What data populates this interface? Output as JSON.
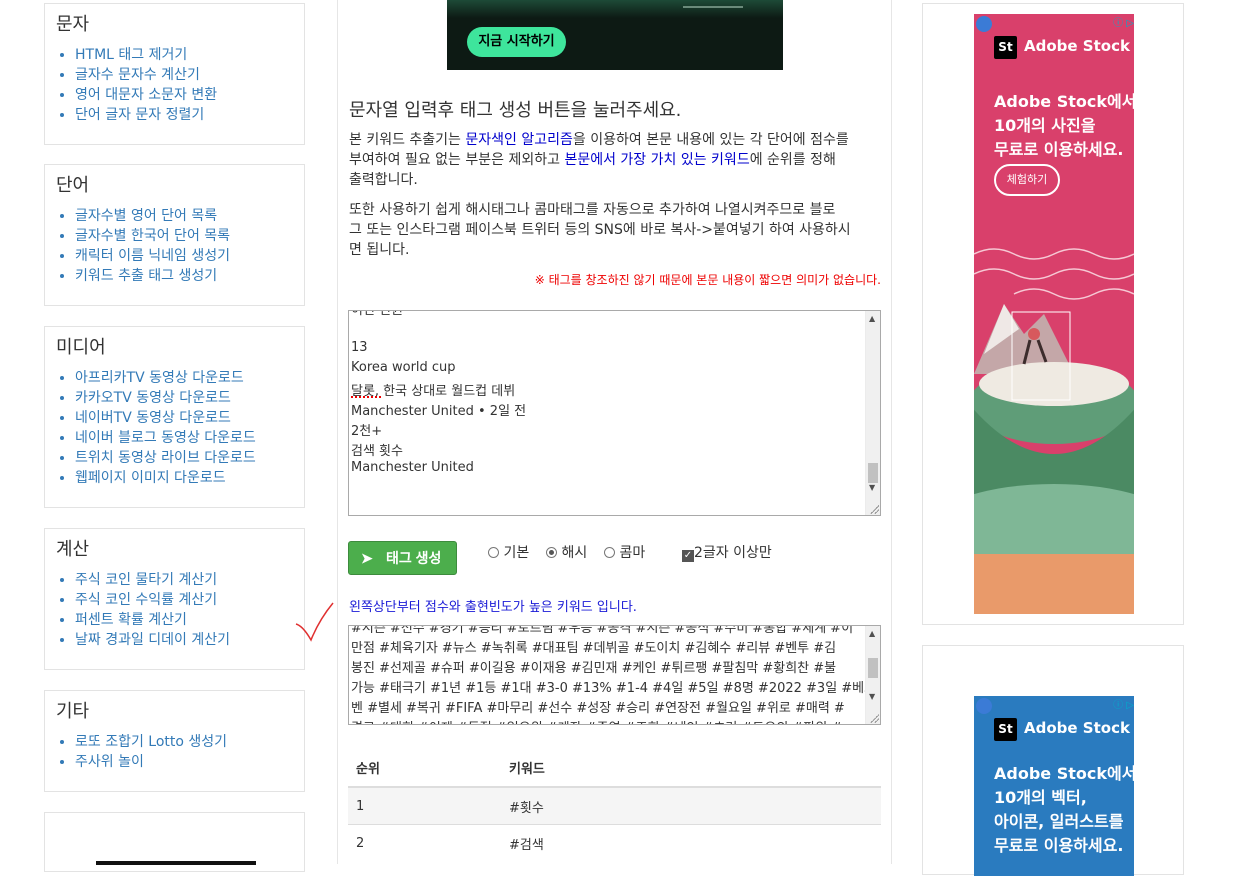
{
  "sidebar": {
    "panels": [
      {
        "title": "문자",
        "items": [
          "HTML 태그 제거기",
          "글자수 문자수 계산기",
          "영어 대문자 소문자 변환",
          "단어 글자 문자 정렬기"
        ]
      },
      {
        "title": "단어",
        "items": [
          "글자수별 영어 단어 목록",
          "글자수별 한국어 단어 목록",
          "캐릭터 이름 닉네임 생성기",
          "키워드 추출 태그 생성기"
        ]
      },
      {
        "title": "미디어",
        "items": [
          "아프리카TV 동영상 다운로드",
          "카카오TV 동영상 다운로드",
          "네이버TV 동영상 다운로드",
          "네이버 블로그 동영상 다운로드",
          "트위치 동영상 라이브 다운로드",
          "웹페이지 이미지 다운로드"
        ]
      },
      {
        "title": "계산",
        "items": [
          "주식 코인 물타기 계산기",
          "주식 코인 수익률 계산기",
          "퍼센트 확률 계산기",
          "날짜 경과일 디데이 계산기"
        ]
      },
      {
        "title": "기타",
        "items": [
          "로또 조합기 Lotto 생성기",
          "주사위 놀이"
        ]
      }
    ]
  },
  "top_ad": {
    "button": "지금 시작하기"
  },
  "main": {
    "title": "문자열 입력후 태그 생성 버튼을 눌러주세요.",
    "para1": [
      {
        "t": "본 키워드 추출기는 ",
        "hl": false
      },
      {
        "t": "문자색인 알고리즘",
        "hl": true
      },
      {
        "t": "을 이용하여 본문 내용에 있는 각 단어에 점수를",
        "hl": false
      },
      {
        "t": "부여하여 필요 없는 부분은 제외하고 ",
        "hl": false
      },
      {
        "t": "본문에서 가장 가치 있는 키워드",
        "hl": true
      },
      {
        "t": "에 순위를 정해",
        "hl": false
      },
      {
        "t": "출력합니다.",
        "hl": false
      }
    ],
    "para2_lines": [
      "또한 사용하기 쉽게 해시태그나 콤마태그를 자동으로 추가하여 나열시켜주므로 블로",
      "그 또는 인스타그램 페이스북 트위터 등의 SNS에 바로 복사->붙여넣기 하여 사용하시",
      "면 됩니다."
    ],
    "warning": "※ 태그를 창조하진 않기 때문에 본문 내용이 짧으면 의미가 없습니다.",
    "input_lines": [
      "13",
      "",
      "Korea world cup",
      "달롯, 한국 상대로 월드컵 데뷔",
      "Manchester United • 2일 전",
      "2천+",
      "검색 횟수",
      "Manchester United"
    ],
    "input_partial": "이번 인원",
    "generate_button": "태그 생성",
    "options": {
      "basic": "기본",
      "hash": "해시",
      "comma": "콤마",
      "min2": "2글자 이상만"
    },
    "result_note": "왼쪽상단부터 점수와 출현빈도가 높은 키워드 입니다.",
    "output_lines": [
      "#시즌 #선수 #경기 #승리 #토트넘 #우승 #공격 #시즌 #공식 #수비 #통합 #세계 #이",
      "만점 #체육기자 #뉴스 #녹취록 #대표팀 #데뷔골 #도이치 #김혜수 #리뷰 #벤투 #김",
      "봉진 #선제골 #슈퍼 #이길용 #이재용 #김민재 #케인 #튀르팽 #팔침막 #황희찬 #불",
      "가능 #태극기 #1년 #1등 #1대 #3-0 #13% #1-4 #4일 #5일 #8명 #2022 #3일 #베토",
      "벤 #별세 #복귀 #FIFA #마무리 #선수 #성장 #승리 #연장전 #월요일 #위로 #매력 #",
      "경고 #대회 #이제 #동점 #일으원 #계좌 #주연 #조회 #네인 #초겨 #도으의 #파워 #"
    ],
    "table": {
      "headers": [
        "순위",
        "키워드"
      ],
      "rows": [
        [
          "1",
          "#횟수"
        ],
        [
          "2",
          "#검색"
        ]
      ]
    }
  },
  "right_ads": [
    {
      "brand": "Adobe Stock",
      "logo": "St",
      "headline": [
        "Adobe Stock에서",
        "10개의 사진을",
        "무료로 이용하세요."
      ],
      "button": "체험하기",
      "bg": "#d9406b"
    },
    {
      "brand": "Adobe Stock",
      "logo": "St",
      "headline": [
        "Adobe Stock에서",
        "10개의 벡터,",
        "아이콘, 일러스트를",
        "무료로 이용하세요."
      ],
      "bg": "#2a7bbf"
    }
  ],
  "colors": {
    "link": "#337ab7",
    "highlight": "#0000cc",
    "warning": "#ee0000",
    "button_green": "#4cae4c",
    "note_blue": "#1a1ad6"
  }
}
